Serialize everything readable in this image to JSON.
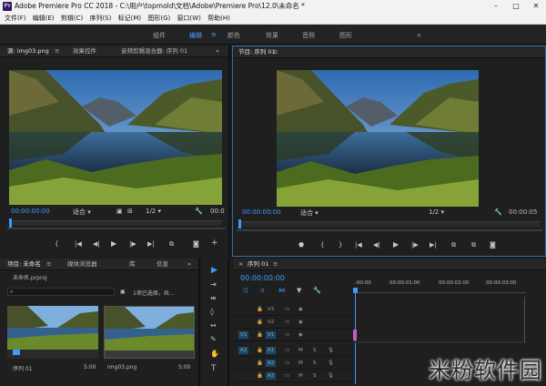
{
  "window": {
    "title": "Adobe Premiere Pro CC 2018 - C:\\用户\\topmold\\文档\\Adobe\\Premiere Pro\\12.0\\未命名 *",
    "logo_text": "Pr"
  },
  "menu": [
    "文件(F)",
    "编辑(E)",
    "剪辑(C)",
    "序列(S)",
    "标记(M)",
    "图形(G)",
    "窗口(W)",
    "帮助(H)"
  ],
  "workspaces": [
    {
      "label": "组件",
      "active": false
    },
    {
      "label": "编辑",
      "active": true
    },
    {
      "label": "颜色",
      "active": false
    },
    {
      "label": "效果",
      "active": false
    },
    {
      "label": "音频",
      "active": false
    },
    {
      "label": "图形",
      "active": false
    }
  ],
  "workspace_more": "»",
  "source_panel": {
    "tabs": [
      "源: img03.png",
      "效果控件",
      "音频剪辑混合器: 序列 01"
    ],
    "timecode": "00:00:00:00",
    "fit": "适合",
    "ratio": "1/2",
    "timecode_right": "00:0"
  },
  "program_panel": {
    "tab": "节目: 序列 01",
    "timecode": "00:00:00:00",
    "fit": "适合",
    "ratio": "1/2",
    "duration": "00:00:05"
  },
  "project_panel": {
    "tabs": [
      "项目: 未命名",
      "媒体浏览器",
      "库",
      "信息"
    ],
    "file": "未命名.prproj",
    "selection": "1项已选择，共...",
    "items": [
      {
        "name": "序列 01",
        "duration": "5:00"
      },
      {
        "name": "img03.png",
        "duration": "5:00"
      }
    ]
  },
  "timeline": {
    "tab": "序列 01",
    "timecode": "00:00:00:00",
    "ruler": [
      ":00:00",
      "00:00:01:00",
      "00:00:02:00",
      "00:00:03:00"
    ],
    "video_tracks": [
      "V3",
      "V2",
      "V1"
    ],
    "audio_tracks": [
      "A1",
      "A2",
      "A3"
    ],
    "source_patch": [
      "V1",
      "A1"
    ],
    "track_letters": [
      "M",
      "S"
    ]
  },
  "watermark": "米粉软件园",
  "colors": {
    "accent": "#3d9bff",
    "panel": "#232323",
    "timeline_clip": "#c05fc0"
  }
}
